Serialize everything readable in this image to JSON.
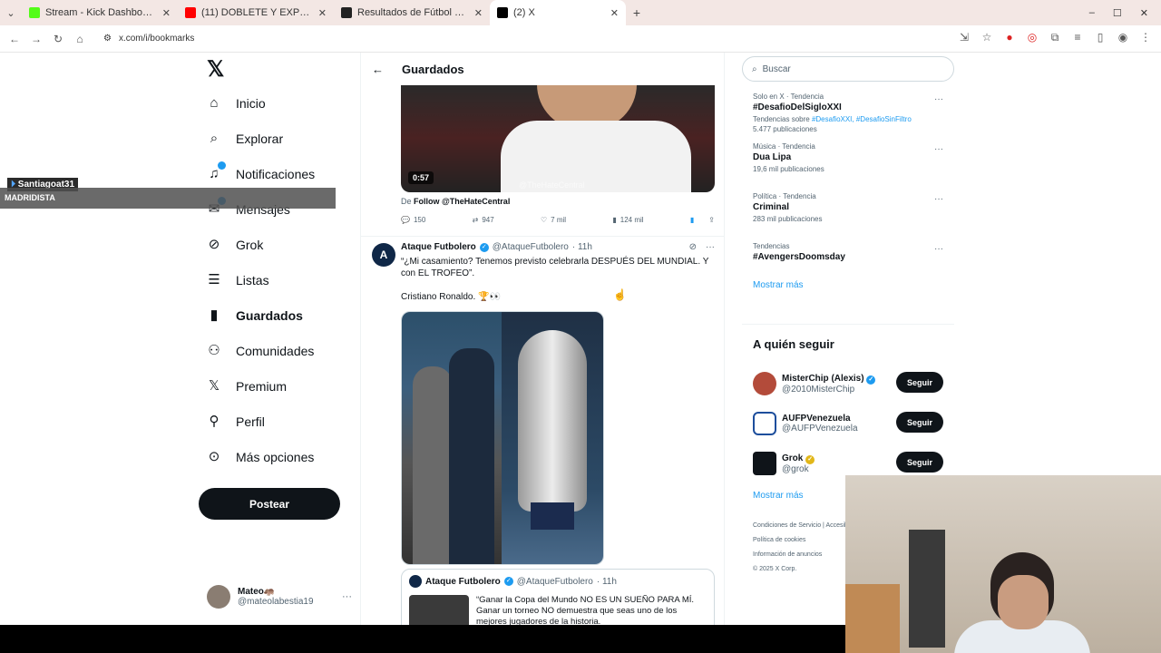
{
  "browser": {
    "tabs": [
      {
        "title": "Stream - Kick Dashboard",
        "color": "#53fc18"
      },
      {
        "title": "(11) DOBLETE Y EXPULSIÓN DE",
        "color": "#ff0000"
      },
      {
        "title": "Resultados de Fútbol y tabla de",
        "color": "#222222"
      },
      {
        "title": "(2) X",
        "color": "#000000"
      }
    ],
    "url": "x.com/i/bookmarks"
  },
  "nav": {
    "items": [
      {
        "label": "Inicio",
        "icon": "home-icon"
      },
      {
        "label": "Explorar",
        "icon": "search-icon"
      },
      {
        "label": "Notificaciones",
        "icon": "bell-icon"
      },
      {
        "label": "Mensajes",
        "icon": "mail-icon"
      },
      {
        "label": "Grok",
        "icon": "grok-icon"
      },
      {
        "label": "Listas",
        "icon": "list-icon"
      },
      {
        "label": "Guardados",
        "icon": "bookmark-icon"
      },
      {
        "label": "Comunidades",
        "icon": "people-icon"
      },
      {
        "label": "Premium",
        "icon": "x-icon"
      },
      {
        "label": "Perfil",
        "icon": "person-icon"
      },
      {
        "label": "Más opciones",
        "icon": "more-icon"
      }
    ],
    "post_label": "Postear",
    "user": {
      "name": "Mateo🦛",
      "handle": "@mateolabestia19"
    }
  },
  "stream_overlay": {
    "user": "Santiagoat31",
    "text": "MADRIDISTA"
  },
  "timeline": {
    "title": "Guardados",
    "video": {
      "duration": "0:57",
      "watermark": "@TheHateCentral"
    },
    "from_prefix": "De",
    "from": "Follow @TheHateCentral",
    "actions": {
      "replies": "150",
      "reposts": "947",
      "likes": "7 mil",
      "views": "124 mil"
    },
    "tweet": {
      "name": "Ataque Futbolero",
      "handle": "@AtaqueFutbolero",
      "time": "· 11h",
      "text": "“¿Mi casamiento? Tenemos previsto celebrarla DESPUÉS DEL MUNDIAL. Y con EL TROFEO”.",
      "text2": "Cristiano Ronaldo. 🏆👀",
      "quote": {
        "name": "Ataque Futbolero",
        "handle": "@AtaqueFutbolero",
        "time": "· 11h",
        "text": "“Ganar la Copa del Mundo NO ES UN SUEÑO PARA MÍ. Ganar un torneo NO demuestra que seas uno de los mejores jugadores de la historia."
      }
    }
  },
  "sidebar": {
    "search_placeholder": "Buscar",
    "trends": [
      {
        "meta": "Solo en X · Tendencia",
        "title": "#DesafioDelSigloXXI",
        "sub_prefix": "Tendencias sobre ",
        "sub_links": "#DesafioXXI, #DesafioSinFiltro",
        "count": "5.477 publicaciones"
      },
      {
        "meta": "Música · Tendencia",
        "title": "Dua Lipa",
        "count": "19,6 mil publicaciones"
      },
      {
        "meta": "Política · Tendencia",
        "title": "Criminal",
        "count": "283 mil publicaciones"
      },
      {
        "meta": "Tendencias",
        "title": "#AvengersDoomsday",
        "count": ""
      }
    ],
    "show_more": "Mostrar más",
    "who_to_follow": {
      "title": "A quién seguir",
      "accounts": [
        {
          "name": "MisterChip (Alexis)",
          "handle": "@2010MisterChip",
          "button": "Seguir"
        },
        {
          "name": "AUFPVenezuela",
          "handle": "@AUFPVenezuela",
          "button": "Seguir"
        },
        {
          "name": "Grok",
          "handle": "@grok",
          "button": "Seguir"
        }
      ],
      "show_more": "Mostrar más"
    },
    "footer": {
      "l1": "Condiciones de Servicio",
      "l2": "Política de cookies",
      "l3": "Accesibilidad",
      "l4": "Información de anuncios",
      "l5": "© 2025 X Corp."
    }
  }
}
